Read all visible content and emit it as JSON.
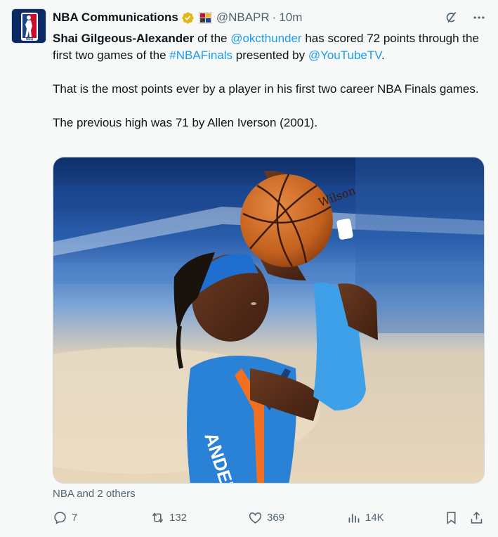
{
  "author": {
    "name": "NBA Communications",
    "handle": "@NBAPR",
    "separator": "·",
    "time": "10m",
    "logo_colors": {
      "blue": "#1d428a",
      "red": "#c8102e",
      "white": "#ffffff"
    }
  },
  "tweet": {
    "segment_1_bold": "Shai Gilgeous-Alexander",
    "segment_2": " of the ",
    "segment_3_link": "@okcthunder",
    "segment_4": " has scored 72 points through the first two games of the ",
    "segment_5_link": "#NBAFinals",
    "segment_6": " presented by ",
    "segment_7_link": "@YouTubeTV",
    "segment_8": ".",
    "paragraph_2": "That is the most points ever by a player in his first two career NBA Finals games.",
    "paragraph_3": "The previous high was 71 by Allen Iverson (2001)."
  },
  "media": {
    "jersey_text": "ANDER",
    "ball_text": "Wilson"
  },
  "annotation": "NBA and 2 others",
  "actions": {
    "replies": "7",
    "reposts": "132",
    "likes": "369",
    "views": "14K"
  },
  "colors": {
    "link": "#1d9bf0",
    "muted": "#536471",
    "verified_gold": "#e2b719"
  }
}
